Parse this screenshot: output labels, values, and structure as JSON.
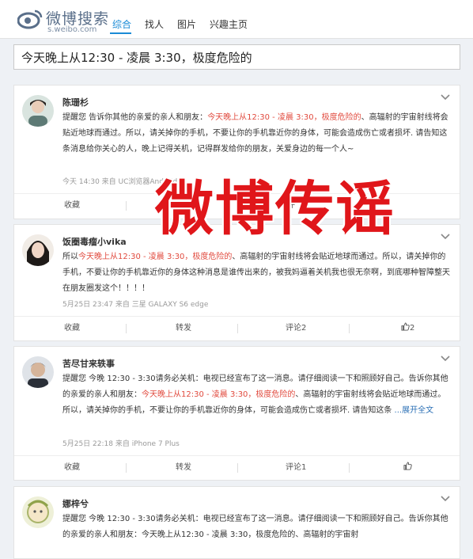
{
  "header": {
    "logo_text": "微博搜索",
    "logo_url": "s.weibo.com",
    "nav": [
      "综合",
      "找人",
      "图片",
      "兴趣主页"
    ]
  },
  "search": {
    "query": "今天晚上从12:30 - 凌晨 3:30，极度危险的"
  },
  "overlay_text": "微博传谣",
  "posts": [
    {
      "user": "陈珊杉",
      "pre": "提醒您 告诉你其他的亲爱的亲人和朋友：",
      "hl": "今天晚上从12:30 - 凌晨 3:30，极度危险的",
      "post": "、高辐射的宇宙射线将会贴近地球而通过。所以，请关掉你的手机，不要让你的手机靠近你的身体，可能会造成伤亡或者损坏. 请告知这条消息给你关心的人，晚上记得关机，记得群发给你的朋友，关爱身边的每一个人~",
      "meta": "今天 14:30 来自 UC浏览器Android版",
      "actions": {
        "fav": "收藏",
        "fwd": "",
        "cmt": "评",
        "like": ""
      }
    },
    {
      "user": "饭圈毒瘤小vika",
      "pre": "所以",
      "hl": "今天晚上从12:30 - 凌晨 3:30，极度危险的",
      "post": "、高辐射的宇宙射线将会贴近地球而通过。所以，请关掉你的手机，不要让你的手机靠近你的身体这种消息是谁传出来的，被我妈逼着关机我也很无奈啊，到底哪种智障整天在朋友圈发这个！！！！",
      "meta": "5月25日 23:47 来自 三星 GALAXY S6 edge",
      "actions": {
        "fav": "收藏",
        "fwd": "转发",
        "cmt": "评论2",
        "like": "2"
      }
    },
    {
      "user": "苦尽甘来轶事",
      "pre": "提醒您 今晚 12:30 - 3:30请务必关机：电视已经宣布了这一消息。请仔细阅读一下和照顾好自己。告诉你其他的亲爱的亲人和朋友：",
      "hl": "今天晚上从12:30 - 凌晨 3:30，极度危险的",
      "post": "、高辐射的宇宙射线将会贴近地球而通过。所以，请关掉你的手机，不要让你的手机靠近你的身体，可能会造成伤亡或者损坏. 请告知这条",
      "more": " ...展开全文",
      "meta": "5月25日 22:18 来自 iPhone 7 Plus",
      "actions": {
        "fav": "收藏",
        "fwd": "转发",
        "cmt": "评论1",
        "like": ""
      }
    },
    {
      "user": "娜梓兮",
      "pre": "提醒您 今晚 12:30 - 3:30请务必关机：电视已经宣布了这一消息。请仔细阅读一下和照顾好自己。告诉你其他的亲爱的亲人和朋友：今天晚上从12:30 - 凌晨 3:30，极度危险的、高辐射的宇宙射",
      "hl": "",
      "post": "",
      "meta": "",
      "actions": {
        "fav": "",
        "fwd": "",
        "cmt": "",
        "like": ""
      }
    }
  ]
}
